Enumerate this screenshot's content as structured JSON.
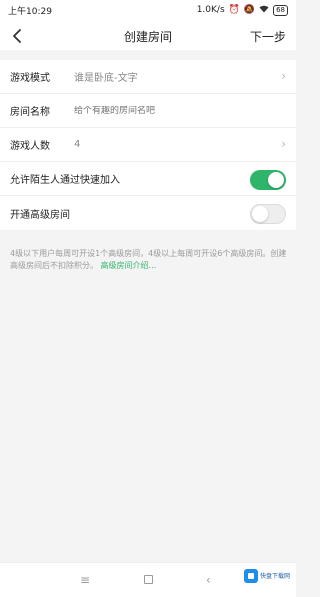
{
  "status_bar": {
    "time": "上午10:29",
    "network_speed": "1.0K/s",
    "battery": "68",
    "icons": [
      "alarm-icon",
      "mute-icon",
      "wifi-icon",
      "battery-icon"
    ]
  },
  "header": {
    "title": "创建房间",
    "next_label": "下一步",
    "back_icon": "back-arrow-icon"
  },
  "form": {
    "game_mode": {
      "label": "游戏模式",
      "value": "谁是卧底-文字"
    },
    "room_name": {
      "label": "房间名称",
      "placeholder": "给个有趣的房间名吧"
    },
    "player_count": {
      "label": "游戏人数",
      "value": "4"
    },
    "allow_strangers": {
      "label": "允许陌生人通过快速加入",
      "on": true
    },
    "advanced_room": {
      "label": "开通高级房间",
      "on": false
    }
  },
  "tip": {
    "text": "4级以下用户每周可开设1个高级房间，4级以上每周可开设6个高级房间。创建高级房间后不扣除积分。",
    "link": "高级房间介绍..."
  },
  "bottom_bar": {
    "watermark_text": "快盘下载网"
  },
  "colors": {
    "accent": "#2fb56a",
    "background": "#f4f4f4"
  }
}
